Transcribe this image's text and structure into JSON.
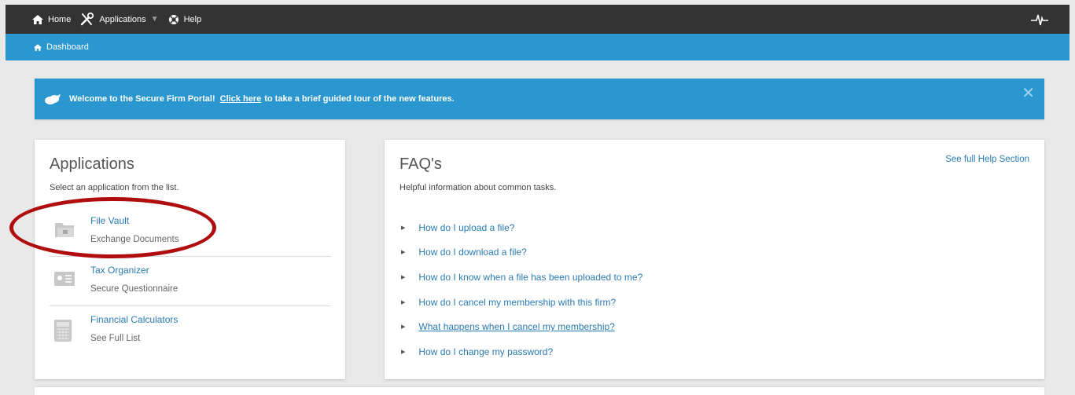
{
  "topbar": {
    "home_label": "Home",
    "applications_label": "Applications",
    "help_label": "Help"
  },
  "breadcrumb": {
    "label": "Dashboard"
  },
  "banner": {
    "welcome_text": "Welcome to the Secure Firm Portal!",
    "link_text": "Click here",
    "rest_text": "to take a brief guided tour of the new features.",
    "close_glyph": "✕"
  },
  "applications": {
    "title": "Applications",
    "subtitle": "Select an application from the list.",
    "items": [
      {
        "title": "File Vault",
        "description": "Exchange Documents",
        "icon": "folder-icon"
      },
      {
        "title": "Tax Organizer",
        "description": "Secure Questionnaire",
        "icon": "id-card-icon"
      },
      {
        "title": "Financial Calculators",
        "description": "See Full List",
        "icon": "calculator-icon"
      }
    ]
  },
  "faq": {
    "title": "FAQ's",
    "subtitle": "Helpful information about common tasks.",
    "help_link": "See full Help Section",
    "questions": [
      "How do I upload a file?",
      "How do I download a file?",
      "How do I know when a file has been uploaded to me?",
      "How do I cancel my membership with this firm?",
      "What happens when I cancel my membership?",
      "How do I change my password?"
    ]
  },
  "colors": {
    "topbar": "#333333",
    "accent_blue": "#2a97d1",
    "link_blue": "#2a7bb3",
    "annotation_red": "#b00e0e"
  }
}
